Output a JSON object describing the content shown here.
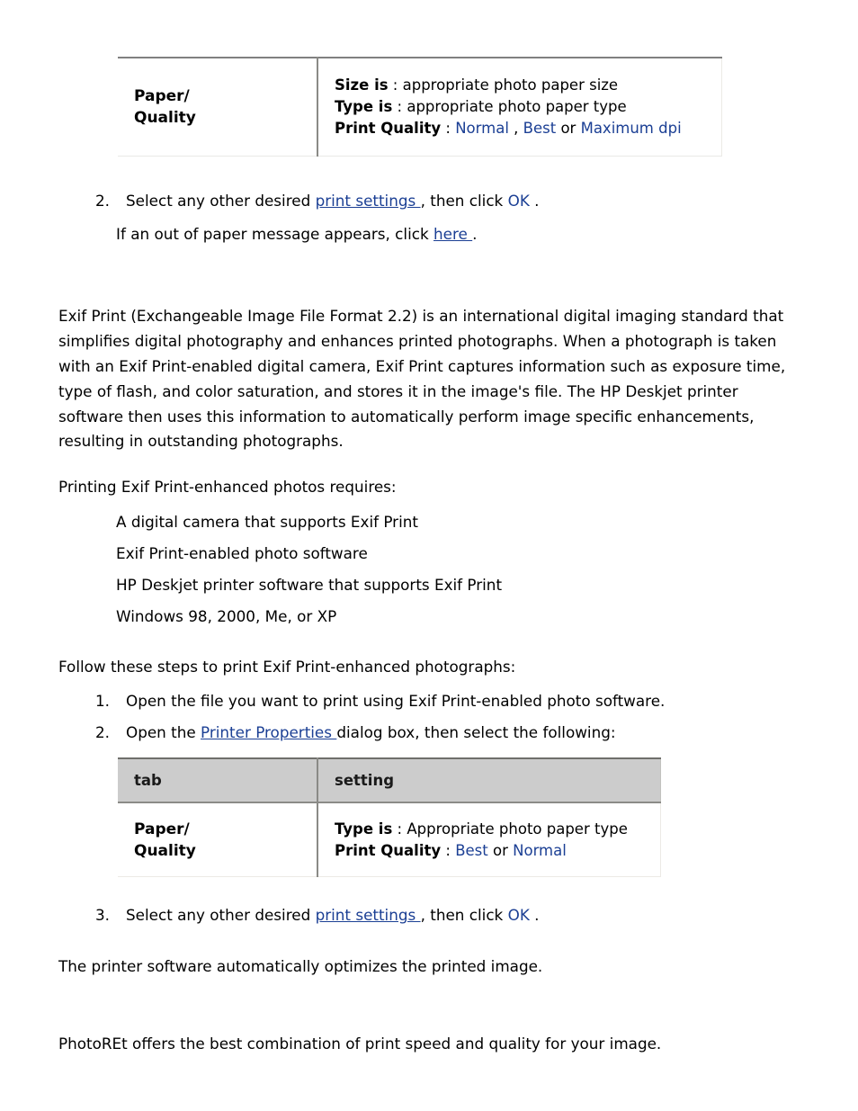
{
  "document": {
    "tables": [
      {
        "id": "top",
        "has_header": false,
        "rows": [
          {
            "tab": "Paper/\nQuality",
            "settings": [
              {
                "label": "Size is",
                "sep": " : ",
                "value": "appropriate photo paper size"
              },
              {
                "label": "Type is",
                "sep": " : ",
                "value": "appropriate photo paper type"
              },
              {
                "label": "Print Quality",
                "sep": " : ",
                "links": [
                  "Normal",
                  "Best",
                  "Maximum dpi"
                ],
                "between": [
                  " , ",
                  " or "
                ]
              }
            ]
          }
        ]
      },
      {
        "id": "bottom",
        "has_header": true,
        "headers": {
          "tab": "tab",
          "setting": "setting"
        },
        "rows": [
          {
            "tab": "Paper/\nQuality",
            "settings": [
              {
                "label": "Type is",
                "sep": " : ",
                "value": "Appropriate photo paper type"
              },
              {
                "label": "Print Quality",
                "sep": " : ",
                "links": [
                  "Best",
                  "Normal"
                ],
                "between": [
                  " or "
                ]
              }
            ]
          }
        ]
      }
    ],
    "step_top": {
      "number": "2.",
      "text_before": "Select any other desired ",
      "link_print_settings": "print settings ",
      "text_middle": ", then click ",
      "link_ok": "OK",
      "text_after": " ."
    },
    "note_out_of_paper": {
      "text_before": "If an out of paper message appears, click ",
      "link_here": "here ",
      "text_after": "."
    },
    "exif_paragraph": "Exif Print (Exchangeable Image File Format 2.2) is an international digital imaging standard that simplifies digital photography and enhances printed photographs. When a photograph is taken with an Exif Print-enabled digital camera, Exif Print captures information such as exposure time, type of flash, and color saturation, and stores it in the image's file. The HP Deskjet printer software then uses this information to automatically perform image specific enhancements, resulting in outstanding photographs.",
    "requires_intro": "Printing Exif Print-enhanced photos requires:",
    "requirements": [
      "A digital camera that supports Exif Print",
      "Exif Print-enabled photo software",
      "HP Deskjet printer software that supports Exif Print",
      "Windows 98, 2000, Me, or XP"
    ],
    "follow_steps_intro": "Follow these steps to print Exif Print-enhanced photographs:",
    "step_1": {
      "number": "1.",
      "text": "Open the file you want to print using Exif Print-enabled photo software."
    },
    "step_2": {
      "number": "2.",
      "text_before": "Open the ",
      "link_printer_properties": "Printer Properties ",
      "text_after": "dialog box, then select the following:"
    },
    "step_3": {
      "number": "3.",
      "text_before": "Select any other desired ",
      "link_print_settings": "print settings ",
      "text_middle": ", then click ",
      "link_ok": "OK",
      "text_after": " ."
    },
    "optimize_note": "The printer software automatically optimizes the printed image.",
    "photoret_note": "PhotoREt offers the best combination of print speed and quality for your image."
  },
  "colors": {
    "link": "#1b3f94",
    "header_bg": "#cccccc",
    "border_dark": "#808080",
    "border_light": "#eceae5",
    "text": "#000000"
  }
}
